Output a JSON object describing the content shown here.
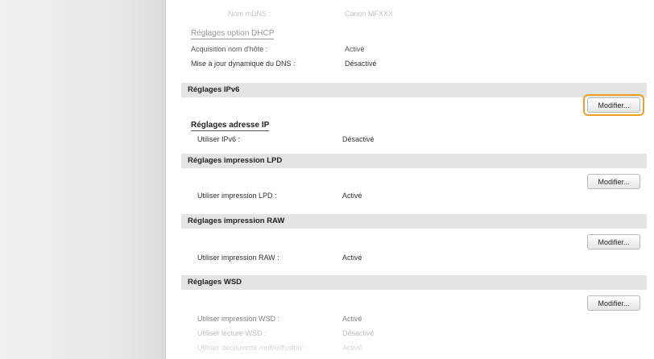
{
  "top": {
    "mdns_label": "Nom mDNS :",
    "mdns_value": "Canon MFXXX",
    "dhcp_heading": "Réglages option DHCP",
    "hostname_label": "Acquisition nom d'hôte :",
    "hostname_value": "Activé",
    "ddns_label": "Mise à jour dynamique du DNS :",
    "ddns_value": "Désactivé"
  },
  "ipv6": {
    "title": "Réglages IPv6",
    "button": "Modifier...",
    "addr_heading": "Réglages adresse IP",
    "use_label": "Utiliser IPv6 :",
    "use_value": "Désactivé"
  },
  "lpd": {
    "title": "Réglages impression LPD",
    "button": "Modifier...",
    "use_label": "Utiliser impression LPD :",
    "use_value": "Activé"
  },
  "raw": {
    "title": "Réglages impression RAW",
    "button": "Modifier...",
    "use_label": "Utiliser impression RAW :",
    "use_value": "Activé"
  },
  "wsd": {
    "title": "Réglages WSD",
    "button": "Modifier...",
    "print_label": "Utiliser impression WSD :",
    "print_value": "Activé",
    "read_label": "Utiliser lecture WSD :",
    "read_value": "Désactivé",
    "multicast_label": "Utiliser découverte multidiffusion :",
    "multicast_value": "Activé"
  },
  "colors": {
    "highlight": "#f0a020",
    "section_bar": "#e4e4e4"
  }
}
